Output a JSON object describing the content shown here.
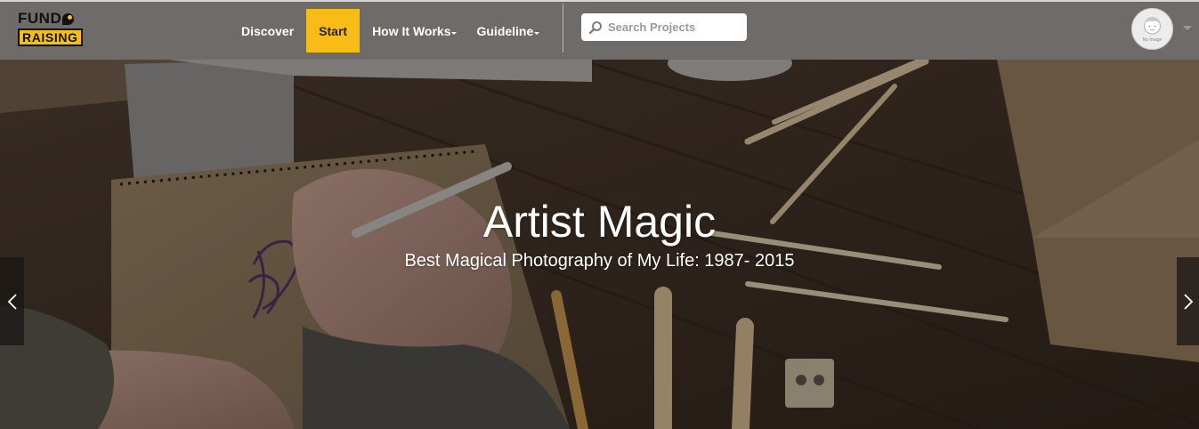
{
  "logo": {
    "line1": "FUND",
    "line2": "RAISING"
  },
  "nav": {
    "items": [
      {
        "label": "Discover",
        "active": false,
        "dropdown": false
      },
      {
        "label": "Start",
        "active": true,
        "dropdown": false
      },
      {
        "label": "How It Works",
        "active": false,
        "dropdown": true
      },
      {
        "label": "Guideline",
        "active": false,
        "dropdown": true
      }
    ]
  },
  "search": {
    "placeholder": "Search Projects",
    "value": ""
  },
  "user": {
    "avatar_label": "No Image"
  },
  "hero": {
    "title": "Artist Magic",
    "subtitle": "Best Magical Photography of My Life: 1987- 2015"
  },
  "colors": {
    "header_bg": "#6e6b69",
    "accent": "#f7bd16",
    "hero_text": "#ffffff"
  },
  "icons": {
    "search": "search-icon",
    "prev": "chevron-left-icon",
    "next": "chevron-right-icon",
    "avatar_dropdown": "caret-down-icon"
  }
}
